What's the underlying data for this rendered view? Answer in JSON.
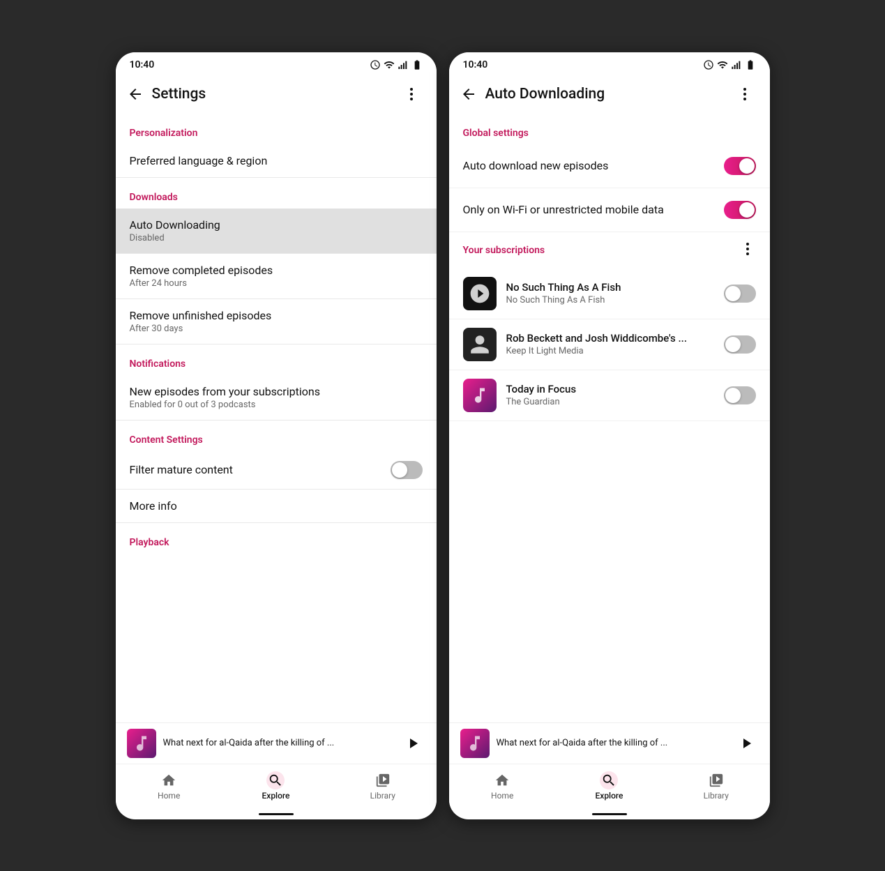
{
  "left_phone": {
    "time": "10:40",
    "title": "Settings",
    "sections": [
      {
        "id": "personalization",
        "label": "Personalization",
        "items": [
          {
            "title": "Preferred language & region",
            "subtitle": null
          }
        ]
      },
      {
        "id": "downloads",
        "label": "Downloads",
        "items": [
          {
            "title": "Auto Downloading",
            "subtitle": "Disabled",
            "highlighted": true
          },
          {
            "title": "Remove completed episodes",
            "subtitle": "After 24 hours"
          },
          {
            "title": "Remove unfinished episodes",
            "subtitle": "After 30 days"
          }
        ]
      },
      {
        "id": "notifications",
        "label": "Notifications",
        "items": [
          {
            "title": "New episodes from your subscriptions",
            "subtitle": "Enabled for 0 out of 3 podcasts"
          }
        ]
      },
      {
        "id": "content_settings",
        "label": "Content Settings",
        "items": [
          {
            "title": "Filter mature content",
            "subtitle": null,
            "toggle": true,
            "toggle_on": false
          },
          {
            "title": "More info",
            "subtitle": null
          }
        ]
      },
      {
        "id": "playback",
        "label": "Playback",
        "items": []
      }
    ],
    "player": {
      "title": "What next for al-Qaida after the killing of ..."
    },
    "nav": {
      "items": [
        {
          "label": "Home",
          "active": false
        },
        {
          "label": "Explore",
          "active": true
        },
        {
          "label": "Library",
          "active": false
        }
      ]
    }
  },
  "right_phone": {
    "time": "10:40",
    "title": "Auto Downloading",
    "global_section_label": "Global settings",
    "global_settings": [
      {
        "label": "Auto download new episodes",
        "toggle_on": true
      },
      {
        "label": "Only on Wi-Fi or unrestricted mobile data",
        "toggle_on": true
      }
    ],
    "subscriptions_label": "Your subscriptions",
    "subscriptions": [
      {
        "name": "No Such Thing As A Fish",
        "author": "No Such Thing As A Fish",
        "toggle_on": false,
        "thumb_type": "fish"
      },
      {
        "name": "Rob Beckett and Josh Widdicombe's ...",
        "author": "Keep It Light Media",
        "toggle_on": false,
        "thumb_type": "rob"
      },
      {
        "name": "Today in Focus",
        "author": "The Guardian",
        "toggle_on": false,
        "thumb_type": "today"
      }
    ],
    "player": {
      "title": "What next for al-Qaida after the killing of ..."
    },
    "nav": {
      "items": [
        {
          "label": "Home",
          "active": false
        },
        {
          "label": "Explore",
          "active": true
        },
        {
          "label": "Library",
          "active": false
        }
      ]
    }
  }
}
